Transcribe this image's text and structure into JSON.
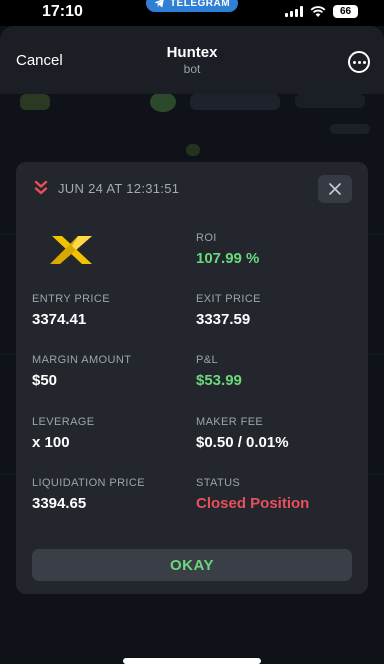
{
  "status_bar": {
    "time": "17:10",
    "telegram_label": "TELEGRAM",
    "battery": "66"
  },
  "header": {
    "cancel_label": "Cancel",
    "title": "Huntex",
    "subtitle": "bot"
  },
  "modal": {
    "timestamp": "JUN 24 AT 12:31:51",
    "logo_icon": "x-logo-icon",
    "roi": {
      "label": "ROI",
      "value": "107.99 %"
    },
    "entry_price": {
      "label": "ENTRY PRICE",
      "value": "3374.41"
    },
    "exit_price": {
      "label": "EXIT PRICE",
      "value": "3337.59"
    },
    "margin_amount": {
      "label": "MARGIN AMOUNT",
      "value": "$50"
    },
    "pnl": {
      "label": "P&L",
      "value": "$53.99"
    },
    "leverage": {
      "label": "LEVERAGE",
      "value": "x 100"
    },
    "maker_fee": {
      "label": "MAKER FEE",
      "value": "$0.50 / 0.01%"
    },
    "liquidation_price": {
      "label": "LIQUIDATION PRICE",
      "value": "3394.65"
    },
    "status": {
      "label": "STATUS",
      "value": "Closed Position"
    },
    "okay_label": "OKAY"
  },
  "colors": {
    "positive": "#69d97b",
    "negative": "#e8505b",
    "card": "#23262d",
    "telegram": "#2f7fd6",
    "logo": "#f2c200"
  }
}
